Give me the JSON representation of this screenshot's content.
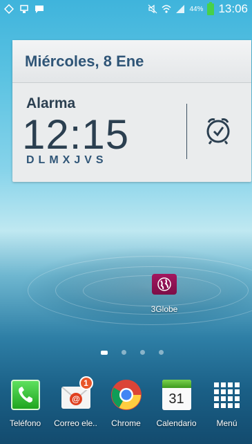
{
  "status_bar": {
    "battery_pct": "44%",
    "time": "13:06",
    "icons": [
      "sync-icon",
      "download-icon",
      "bbm-icon",
      "mute-icon",
      "wifi-icon",
      "signal-icon",
      "battery-icon"
    ]
  },
  "clock_widget": {
    "date": "Miércoles, 8 Ene",
    "alarm_label": "Alarma",
    "alarm_time": "12:15",
    "alarm_days": "DLMXJVS",
    "icon": "alarm-clock-icon"
  },
  "home_apps": [
    {
      "label": "3Globe",
      "icon": "3globe-icon",
      "color": "#9a1457"
    }
  ],
  "pager": {
    "pages": 4,
    "active_index": 0
  },
  "dock": [
    {
      "label": "Teléfono",
      "icon": "phone-icon",
      "color": "#2fbf2f"
    },
    {
      "label": "Correo ele..",
      "icon": "email-icon",
      "badge": "1",
      "color": "#e8562a"
    },
    {
      "label": "Chrome",
      "icon": "chrome-icon"
    },
    {
      "label": "Calendario",
      "icon": "calendar-icon",
      "day": "31",
      "color": "#4aa82a"
    },
    {
      "label": "Menú",
      "icon": "apps-grid-icon"
    }
  ]
}
